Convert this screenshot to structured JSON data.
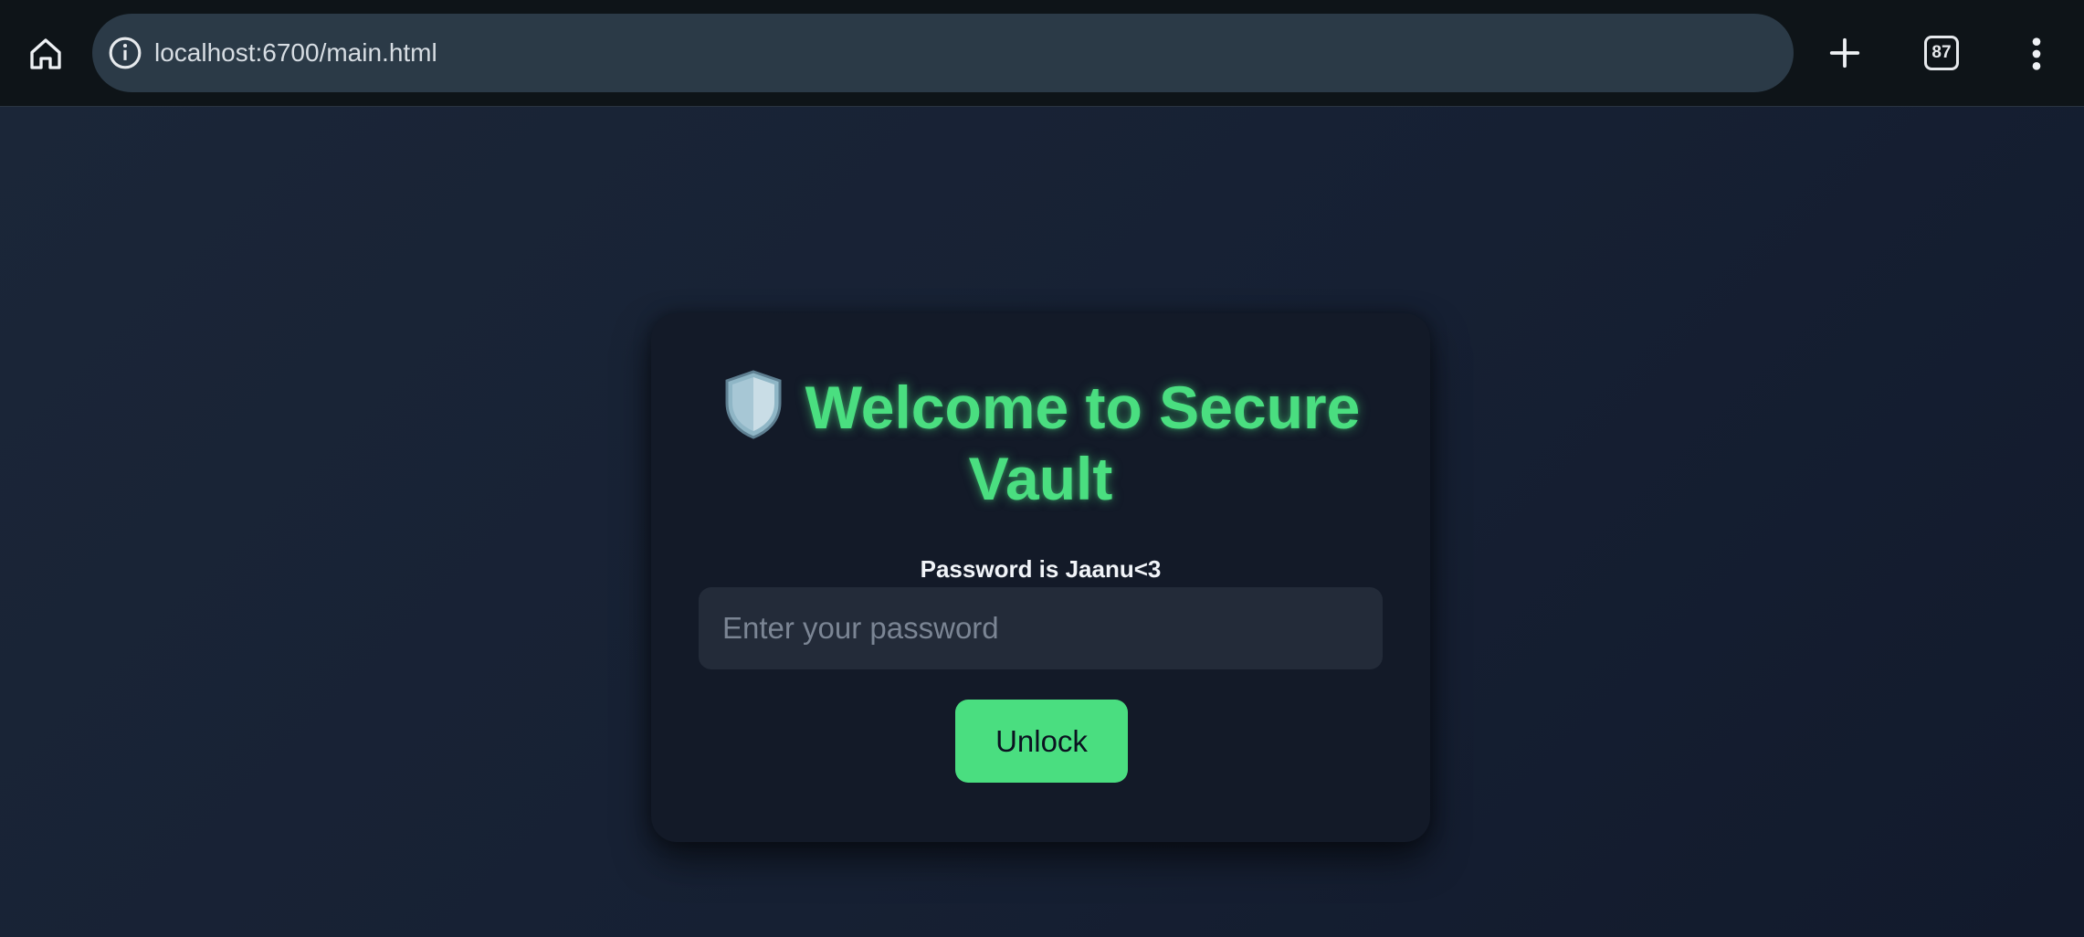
{
  "browser": {
    "url": "localhost:6700/main.html",
    "tab_count": "87",
    "icons": {
      "home": "home-icon",
      "info": "info-icon",
      "new_tab": "plus-icon",
      "tabs": "tab-switcher-icon",
      "menu": "more-vert-icon"
    }
  },
  "vault": {
    "title": "Welcome to Secure Vault",
    "title_icon": "shield-icon",
    "hint": "Password is Jaanu<3",
    "password_placeholder": "Enter your password",
    "password_value": "",
    "unlock_label": "Unlock",
    "colors": {
      "accent": "#4ade80",
      "card_bg": "#131a28",
      "input_bg": "#232b39",
      "page_bg": "#1b2638"
    }
  }
}
